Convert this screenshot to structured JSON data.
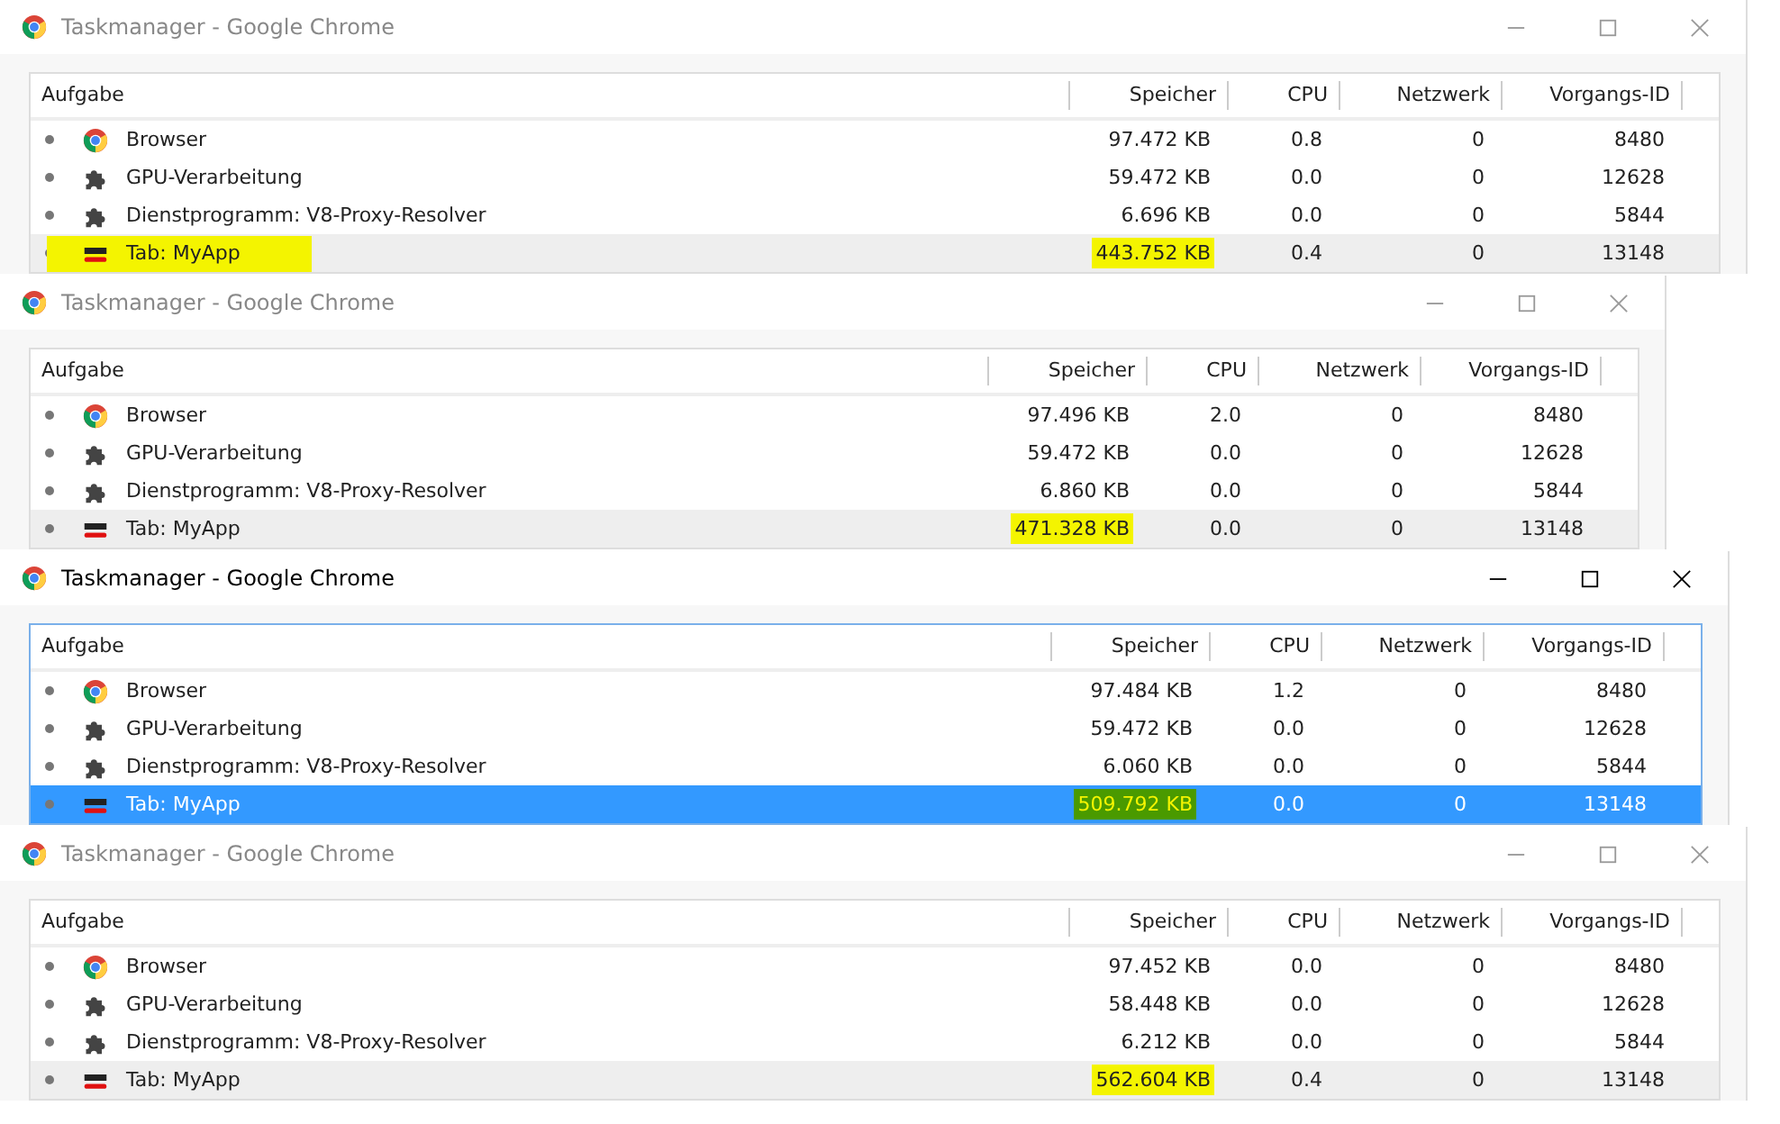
{
  "windows": [
    {
      "title": "Taskmanager - Google Chrome",
      "focused": false,
      "columns": [
        "Aufgabe",
        "Speicher",
        "CPU",
        "Netzwerk",
        "Vorgangs-ID"
      ],
      "rows": [
        {
          "kind": "chrome",
          "task": "Browser",
          "memory": "97.472 KB",
          "cpu": "0.8",
          "network": "0",
          "pid": "8480",
          "selected": false,
          "task_marked": false,
          "memory_marked": false
        },
        {
          "kind": "puzzle",
          "task": "GPU-Verarbeitung",
          "memory": "59.472 KB",
          "cpu": "0.0",
          "network": "0",
          "pid": "12628",
          "selected": false,
          "task_marked": false,
          "memory_marked": false
        },
        {
          "kind": "puzzle",
          "task": "Dienstprogramm: V8-Proxy-Resolver",
          "memory": "6.696 KB",
          "cpu": "0.0",
          "network": "0",
          "pid": "5844",
          "selected": false,
          "task_marked": false,
          "memory_marked": false
        },
        {
          "kind": "tab",
          "task": "Tab: MyApp",
          "memory": "443.752 KB",
          "cpu": "0.4",
          "network": "0",
          "pid": "13148",
          "selected": true,
          "task_marked": true,
          "memory_marked": true
        }
      ]
    },
    {
      "title": "Taskmanager - Google Chrome",
      "focused": false,
      "columns": [
        "Aufgabe",
        "Speicher",
        "CPU",
        "Netzwerk",
        "Vorgangs-ID"
      ],
      "rows": [
        {
          "kind": "chrome",
          "task": "Browser",
          "memory": "97.496 KB",
          "cpu": "2.0",
          "network": "0",
          "pid": "8480",
          "selected": false,
          "task_marked": false,
          "memory_marked": false
        },
        {
          "kind": "puzzle",
          "task": "GPU-Verarbeitung",
          "memory": "59.472 KB",
          "cpu": "0.0",
          "network": "0",
          "pid": "12628",
          "selected": false,
          "task_marked": false,
          "memory_marked": false
        },
        {
          "kind": "puzzle",
          "task": "Dienstprogramm: V8-Proxy-Resolver",
          "memory": "6.860 KB",
          "cpu": "0.0",
          "network": "0",
          "pid": "5844",
          "selected": false,
          "task_marked": false,
          "memory_marked": false
        },
        {
          "kind": "tab",
          "task": "Tab: MyApp",
          "memory": "471.328 KB",
          "cpu": "0.0",
          "network": "0",
          "pid": "13148",
          "selected": true,
          "task_marked": false,
          "memory_marked": true
        }
      ]
    },
    {
      "title": "Taskmanager - Google Chrome",
      "focused": true,
      "columns": [
        "Aufgabe",
        "Speicher",
        "CPU",
        "Netzwerk",
        "Vorgangs-ID"
      ],
      "rows": [
        {
          "kind": "chrome",
          "task": "Browser",
          "memory": "97.484 KB",
          "cpu": "1.2",
          "network": "0",
          "pid": "8480",
          "selected": false,
          "task_marked": false,
          "memory_marked": false
        },
        {
          "kind": "puzzle",
          "task": "GPU-Verarbeitung",
          "memory": "59.472 KB",
          "cpu": "0.0",
          "network": "0",
          "pid": "12628",
          "selected": false,
          "task_marked": false,
          "memory_marked": false
        },
        {
          "kind": "puzzle",
          "task": "Dienstprogramm: V8-Proxy-Resolver",
          "memory": "6.060 KB",
          "cpu": "0.0",
          "network": "0",
          "pid": "5844",
          "selected": false,
          "task_marked": false,
          "memory_marked": false
        },
        {
          "kind": "tab",
          "task": "Tab: MyApp",
          "memory": "509.792 KB",
          "cpu": "0.0",
          "network": "0",
          "pid": "13148",
          "selected": true,
          "task_marked": false,
          "memory_marked": true
        }
      ]
    },
    {
      "title": "Taskmanager - Google Chrome",
      "focused": false,
      "columns": [
        "Aufgabe",
        "Speicher",
        "CPU",
        "Netzwerk",
        "Vorgangs-ID"
      ],
      "rows": [
        {
          "kind": "chrome",
          "task": "Browser",
          "memory": "97.452 KB",
          "cpu": "0.0",
          "network": "0",
          "pid": "8480",
          "selected": false,
          "task_marked": false,
          "memory_marked": false
        },
        {
          "kind": "puzzle",
          "task": "GPU-Verarbeitung",
          "memory": "58.448 KB",
          "cpu": "0.0",
          "network": "0",
          "pid": "12628",
          "selected": false,
          "task_marked": false,
          "memory_marked": false
        },
        {
          "kind": "puzzle",
          "task": "Dienstprogramm: V8-Proxy-Resolver",
          "memory": "6.212 KB",
          "cpu": "0.0",
          "network": "0",
          "pid": "5844",
          "selected": false,
          "task_marked": false,
          "memory_marked": false
        },
        {
          "kind": "tab",
          "task": "Tab: MyApp",
          "memory": "562.604 KB",
          "cpu": "0.4",
          "network": "0",
          "pid": "13148",
          "selected": true,
          "task_marked": false,
          "memory_marked": true
        }
      ]
    }
  ]
}
